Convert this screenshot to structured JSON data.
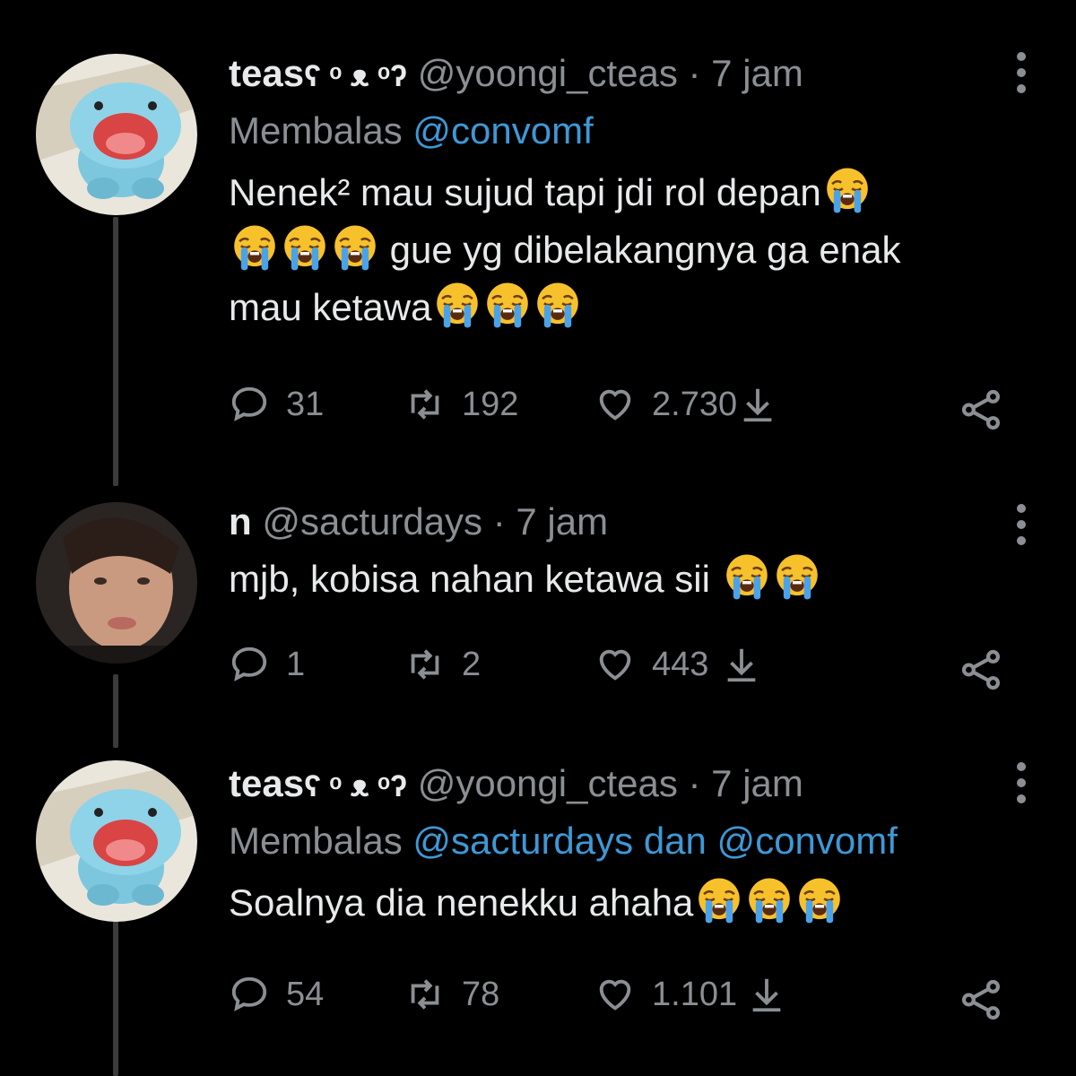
{
  "tweets": [
    {
      "display_name": "teas",
      "name_deco": "ʕ ᵒ ᴥ ᵒʔ",
      "handle": "@yoongi_cteas",
      "time": "· 7 jam",
      "replying_prefix": "Membalas",
      "replying_to": "@convomf",
      "text_lines": [
        "Nenek² mau sujud tapi jdi rol depan",
        "gue yg dibelakangnya ga enak",
        "mau ketawa"
      ],
      "reply_count": "31",
      "retweet_count": "192",
      "like_count": "2.730"
    },
    {
      "display_name": "n",
      "handle": "@sacturdays",
      "time": "· 7 jam",
      "text_lines": [
        "mjb, kobisa nahan ketawa sii"
      ],
      "reply_count": "1",
      "retweet_count": "2",
      "like_count": "443"
    },
    {
      "display_name": "teas",
      "name_deco": "ʕ ᵒ ᴥ ᵒʔ",
      "handle": "@yoongi_cteas",
      "time": "· 7 jam",
      "replying_prefix": "Membalas",
      "replying_to": "@sacturdays dan @convomf",
      "text_lines": [
        "Soalnya dia nenekku ahaha"
      ],
      "reply_count": "54",
      "retweet_count": "78",
      "like_count": "1.101"
    }
  ],
  "icons": {
    "emoji": "loudly-crying-face",
    "reply": "reply-bubble-icon",
    "retweet": "retweet-icon",
    "like": "heart-icon",
    "download": "download-arrow-icon",
    "share": "share-icon",
    "more": "more-options-icon"
  },
  "colors": {
    "background": "#000000",
    "mention": "#3e98d6",
    "muted": "#8b8f93",
    "text": "#e7e9ea"
  }
}
